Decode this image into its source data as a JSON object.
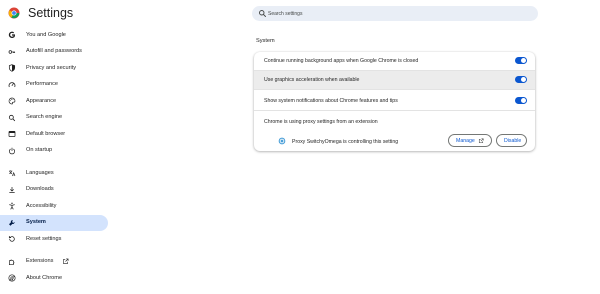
{
  "app": {
    "title": "Settings"
  },
  "search": {
    "placeholder": "Search settings"
  },
  "sidebar": {
    "items": [
      {
        "label": "You and Google",
        "icon": "google-g-icon"
      },
      {
        "label": "Autofill and passwords",
        "icon": "key-icon"
      },
      {
        "label": "Privacy and security",
        "icon": "shield-icon"
      },
      {
        "label": "Performance",
        "icon": "speedometer-icon"
      },
      {
        "label": "Appearance",
        "icon": "palette-icon"
      },
      {
        "label": "Search engine",
        "icon": "search-icon"
      },
      {
        "label": "Default browser",
        "icon": "browser-window-icon"
      },
      {
        "label": "On startup",
        "icon": "power-icon"
      },
      {
        "label": "Languages",
        "icon": "translate-icon"
      },
      {
        "label": "Downloads",
        "icon": "download-icon"
      },
      {
        "label": "Accessibility",
        "icon": "accessibility-icon"
      },
      {
        "label": "System",
        "icon": "wrench-icon",
        "active": true
      },
      {
        "label": "Reset settings",
        "icon": "reset-icon"
      },
      {
        "label": "Extensions",
        "icon": "puzzle-icon",
        "external": true
      },
      {
        "label": "About Chrome",
        "icon": "chrome-icon"
      }
    ]
  },
  "main": {
    "section_title": "System",
    "rows": [
      {
        "label": "Continue running background apps when Google Chrome is closed",
        "toggle": true
      },
      {
        "label": "Use graphics acceleration when available",
        "toggle": true,
        "highlighted": true
      },
      {
        "label": "Show system notifications about Chrome features and tips",
        "toggle": true
      },
      {
        "label": "Chrome is using proxy settings from an extension"
      }
    ],
    "proxy": {
      "extension_text": "Proxy SwitchyOmega is controlling this setting",
      "manage_label": "Manage",
      "disable_label": "Disable"
    }
  },
  "colors": {
    "accent": "#0b57d0",
    "active_nav": "#d3e3fd",
    "search_bg": "#e9eef6"
  }
}
